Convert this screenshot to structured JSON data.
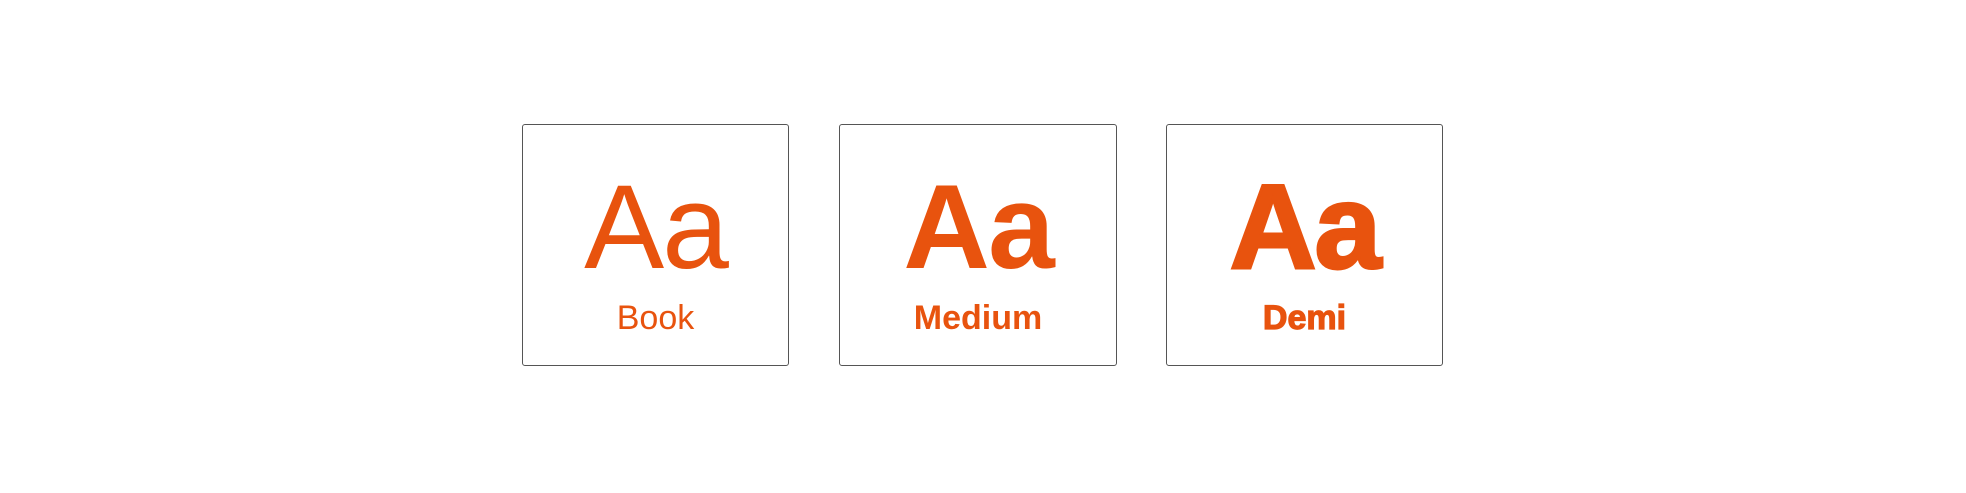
{
  "accent_color": "#e8530e",
  "border_color": "#555555",
  "specimens": [
    {
      "glyph": "Aa",
      "label": "Book"
    },
    {
      "glyph": "Aa",
      "label": "Medium"
    },
    {
      "glyph": "Aa",
      "label": "Demi"
    }
  ]
}
